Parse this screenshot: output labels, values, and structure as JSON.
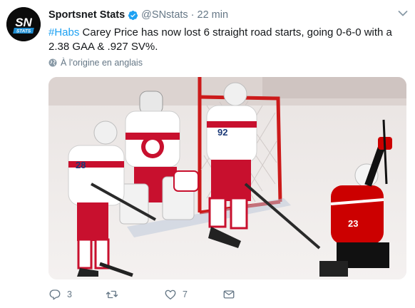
{
  "tweet": {
    "author": {
      "display_name": "Sportsnet Stats",
      "handle": "@SNstats",
      "verified": true,
      "avatar_text": "SN",
      "avatar_subtext": "STATS"
    },
    "separator": "·",
    "time": "22 min",
    "hashtag": "#Habs",
    "body": " Carey Price has now lost 6 straight road starts, going 0-6-0 with a 2.38 GAA & .927 SV%.",
    "translate_label": "À l'origine en anglais",
    "photo": {
      "jersey_numbers": [
        "28",
        "92",
        "23"
      ]
    },
    "actions": {
      "reply_count": "3",
      "retweet_count": "",
      "like_count": "7",
      "message_count": ""
    }
  },
  "colors": {
    "link": "#1da1f2",
    "secondary_text": "#657786",
    "canadiens_red": "#c8102e",
    "hurricanes_red": "#cc0000"
  },
  "icons": [
    "verified-icon",
    "chevron-down-icon",
    "globe-icon",
    "reply-icon",
    "retweet-icon",
    "like-icon",
    "message-icon"
  ]
}
